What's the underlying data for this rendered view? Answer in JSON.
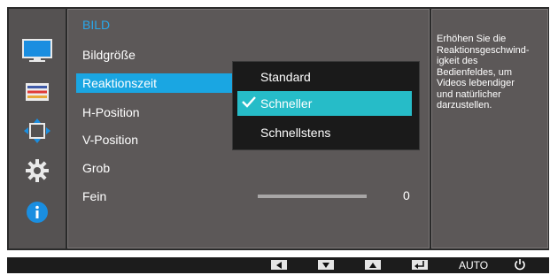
{
  "colors": {
    "accent_blue": "#2aa6e8",
    "selection_blue": "#1aa6e2",
    "submenu_selection": "#26bcc8",
    "panel_gray": "#5c5858",
    "sidebar_gray": "#555252"
  },
  "sidebar": {
    "icons": [
      "monitor-icon",
      "settings-list-icon",
      "position-arrows-icon",
      "gear-icon",
      "info-icon"
    ],
    "selected_index": 0
  },
  "menu": {
    "title": "BILD",
    "items": [
      "Bildgröße",
      "Reaktionszeit",
      "H-Position",
      "V-Position",
      "Grob",
      "Fein"
    ],
    "selected_item": "Reaktionszeit"
  },
  "submenu": {
    "options": [
      "Standard",
      "Schneller",
      "Schnellstens"
    ],
    "selected": "Schneller"
  },
  "fein": {
    "value": "0"
  },
  "help": {
    "text": "Erhöhen Sie die\nReaktionsgeschwind-\nigkeit des\nBedienfeldes, um\nVideos lebendiger\nund natürlicher\ndarzustellen."
  },
  "bottom_bar": {
    "buttons": [
      "left-arrow-icon",
      "down-arrow-icon",
      "up-arrow-icon",
      "enter-icon"
    ],
    "auto_label": "AUTO",
    "power_icon": "power-icon"
  }
}
